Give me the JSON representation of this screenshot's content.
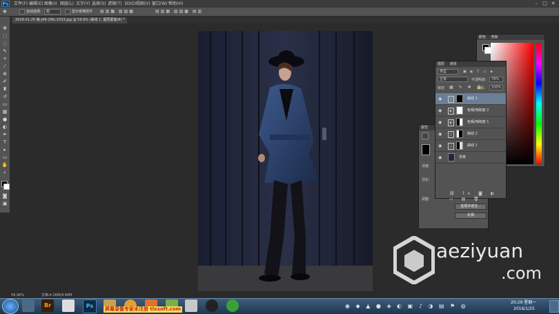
{
  "app": {
    "logo": "Ps"
  },
  "menubar": {
    "items": [
      "文件(F)",
      "编辑(E)",
      "图像(I)",
      "图层(L)",
      "文字(Y)",
      "选择(S)",
      "滤镜(T)",
      "3D(D)",
      "视图(V)",
      "窗口(W)",
      "帮助(H)"
    ],
    "window_buttons": [
      "–",
      "□",
      "✕"
    ]
  },
  "options_bar": {
    "auto_select_label": "自动选择:",
    "auto_select_value": "组",
    "show_transform_label": "显示变换控件"
  },
  "document": {
    "tab_title": "2016-01-25-第-J46-2WL-1033.jpg @ 59.9% (曲线 1, 图层蒙版/8) *"
  },
  "status_bar": {
    "zoom": "59.96%",
    "doc_info": "文档:4.26M/9.94M"
  },
  "color_panel": {
    "tabs": [
      "颜色",
      "色板"
    ]
  },
  "layers_panel": {
    "tabs": [
      "图层",
      "通道"
    ],
    "filter_kind": "类型",
    "blend_mode": "正常",
    "opacity_label": "不透明度:",
    "opacity_value": "78%",
    "lock_label": "锁定:",
    "fill_label": "填充:",
    "fill_value": "100%",
    "layers": [
      {
        "name": "曲线 1",
        "selected": true,
        "thumb": "black-mask"
      },
      {
        "name": "色相/饱和度 2",
        "selected": false,
        "thumb": "white"
      },
      {
        "name": "色相/饱和度 1",
        "selected": false,
        "thumb": "mixed"
      },
      {
        "name": "曲线 2",
        "selected": false,
        "thumb": "mixed"
      },
      {
        "name": "曲线 1",
        "selected": false,
        "thumb": "mixed"
      },
      {
        "name": "背景",
        "selected": false,
        "thumb": "photo"
      }
    ]
  },
  "properties_panel": {
    "title": "属性",
    "density_label": "浓度:",
    "feather_label": "羽化:",
    "adjust_label": "调整:",
    "select_button": "选择并遮住...",
    "invert_button": "反相"
  },
  "watermark": {
    "brand": "aeziyuan",
    "domain": ".com"
  },
  "taskbar": {
    "apps": [
      "Br",
      "Ps"
    ],
    "marquee_text": "屏幕录像专家未注册 tlxsoft.com",
    "time": "20:29 星期一",
    "date": "2016/1/25"
  },
  "colors": {
    "accent": "#4fb3ff",
    "panel": "#535353",
    "selected_row": "#6a7e96"
  }
}
